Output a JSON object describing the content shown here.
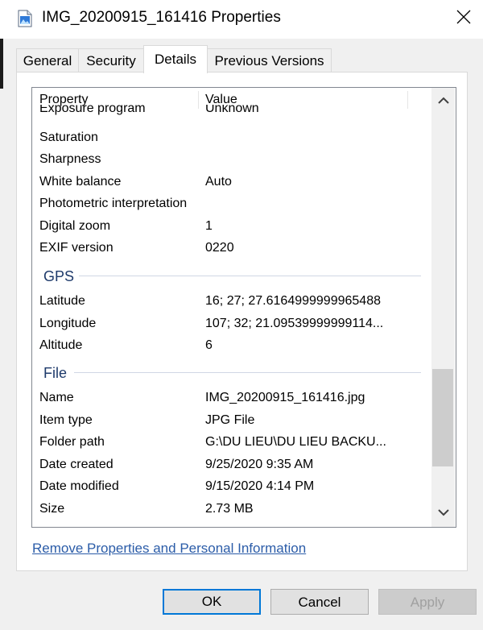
{
  "window": {
    "title": "IMG_20200915_161416 Properties"
  },
  "tabs": [
    {
      "label": "General",
      "active": false
    },
    {
      "label": "Security",
      "active": false
    },
    {
      "label": "Details",
      "active": true
    },
    {
      "label": "Previous Versions",
      "active": false
    }
  ],
  "columns": {
    "property": "Property",
    "value": "Value"
  },
  "rows_top": [
    {
      "k": "Exposure program",
      "v": "Unknown"
    },
    {
      "k": "Saturation",
      "v": ""
    },
    {
      "k": "Sharpness",
      "v": ""
    },
    {
      "k": "White balance",
      "v": "Auto"
    },
    {
      "k": "Photometric interpretation",
      "v": ""
    },
    {
      "k": "Digital zoom",
      "v": "1"
    },
    {
      "k": "EXIF version",
      "v": "0220"
    }
  ],
  "gps": {
    "title": "GPS",
    "rows": [
      {
        "k": "Latitude",
        "v": "16; 27; 27.6164999999965488"
      },
      {
        "k": "Longitude",
        "v": "107; 32; 21.09539999999114..."
      },
      {
        "k": "Altitude",
        "v": "6"
      }
    ]
  },
  "file": {
    "title": "File",
    "rows": [
      {
        "k": "Name",
        "v": "IMG_20200915_161416.jpg"
      },
      {
        "k": "Item type",
        "v": "JPG File"
      },
      {
        "k": "Folder path",
        "v": "G:\\DU LIEU\\DU LIEU BACKU..."
      },
      {
        "k": "Date created",
        "v": "9/25/2020 9:35 AM"
      },
      {
        "k": "Date modified",
        "v": "9/15/2020 4:14 PM"
      },
      {
        "k": "Size",
        "v": "2.73 MB"
      }
    ]
  },
  "link_text": "Remove Properties and Personal Information",
  "buttons": {
    "ok": "OK",
    "cancel": "Cancel",
    "apply": "Apply"
  },
  "colors": {
    "accent": "#0078d7",
    "group_title": "#1e3a6b",
    "link": "#2b5ca8"
  },
  "icons": [
    "image-file-icon",
    "close-icon",
    "scroll-up-icon",
    "scroll-down-icon"
  ]
}
